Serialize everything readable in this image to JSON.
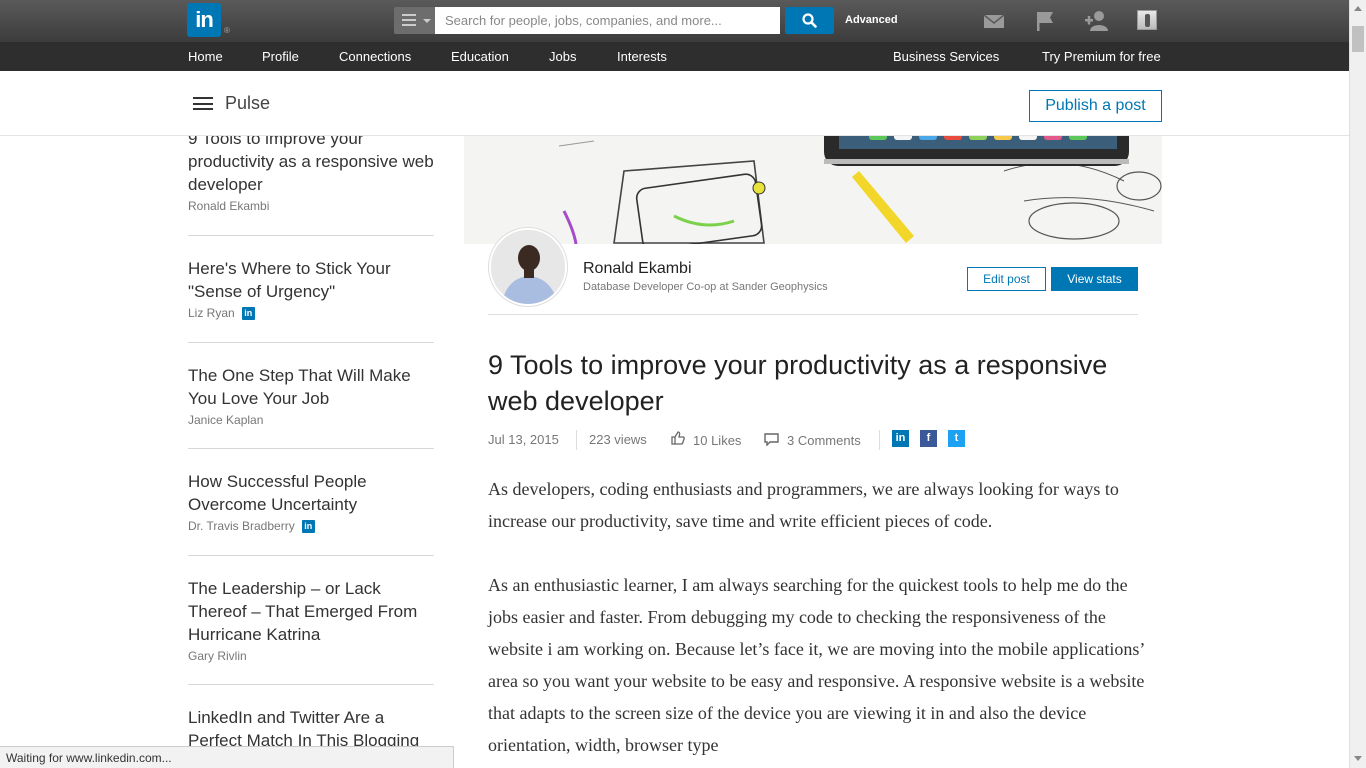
{
  "topbar": {
    "logo_text": "in",
    "logo_reg": "®",
    "search_placeholder": "Search for people, jobs, companies, and more...",
    "advanced_label": "Advanced",
    "icons": [
      "mail-icon",
      "flag-icon",
      "add-connection-icon",
      "profile-avatar"
    ]
  },
  "nav": {
    "items": [
      "Home",
      "Profile",
      "Connections",
      "Education",
      "Jobs",
      "Interests"
    ],
    "right_items": [
      "Business Services",
      "Try Premium for free"
    ]
  },
  "pulse": {
    "title": "Pulse",
    "publish_label": "Publish a post"
  },
  "sidebar": {
    "items": [
      {
        "title": "9 Tools to improve your productivity as a responsive web developer",
        "author": "Ronald Ekambi",
        "influencer": false
      },
      {
        "title": "Here's Where to Stick Your \"Sense of Urgency\"",
        "author": "Liz Ryan",
        "influencer": true
      },
      {
        "title": "The One Step That Will Make You Love Your Job",
        "author": "Janice Kaplan",
        "influencer": false
      },
      {
        "title": "How Successful People Overcome Uncertainty",
        "author": "Dr. Travis Bradberry",
        "influencer": true
      },
      {
        "title": "The Leadership – or Lack Thereof – That Emerged From Hurricane Katrina",
        "author": "Gary Rivlin",
        "influencer": false
      },
      {
        "title": "LinkedIn and Twitter Are a Perfect Match In This Blogging",
        "author": "",
        "influencer": false
      }
    ],
    "influencer_badge": "in"
  },
  "author": {
    "name": "Ronald Ekambi",
    "headline": "Database Developer Co-op at Sander Geophysics",
    "edit_label": "Edit post",
    "stats_label": "View stats"
  },
  "article": {
    "title": "9 Tools to improve your productivity as a responsive web developer",
    "date": "Jul 13, 2015",
    "views": "223 views",
    "likes": "10 Likes",
    "comments": "3 Comments",
    "share": {
      "linkedin": "in",
      "facebook": "f",
      "twitter": "t"
    },
    "paragraphs": [
      "As developers, coding enthusiasts and programmers, we are always looking for ways to increase our productivity, save time and  write  efficient pieces of code.",
      "As an enthusiastic learner, I am always searching for the quickest tools to help me do the jobs easier and faster. From debugging my code to checking the responsiveness of the website i am working on. Because let’s face it, we are moving into the mobile applications’ area so you want your website to be easy and responsive. A responsive website is a website that adapts to the screen size of the device you are viewing it in and also the device orientation, width, browser type"
    ]
  },
  "colors": {
    "brand": "#0077b5",
    "topbar": "#4a4a4a",
    "navbar": "#2e2e2e"
  },
  "status": "Waiting for www.linkedin.com..."
}
